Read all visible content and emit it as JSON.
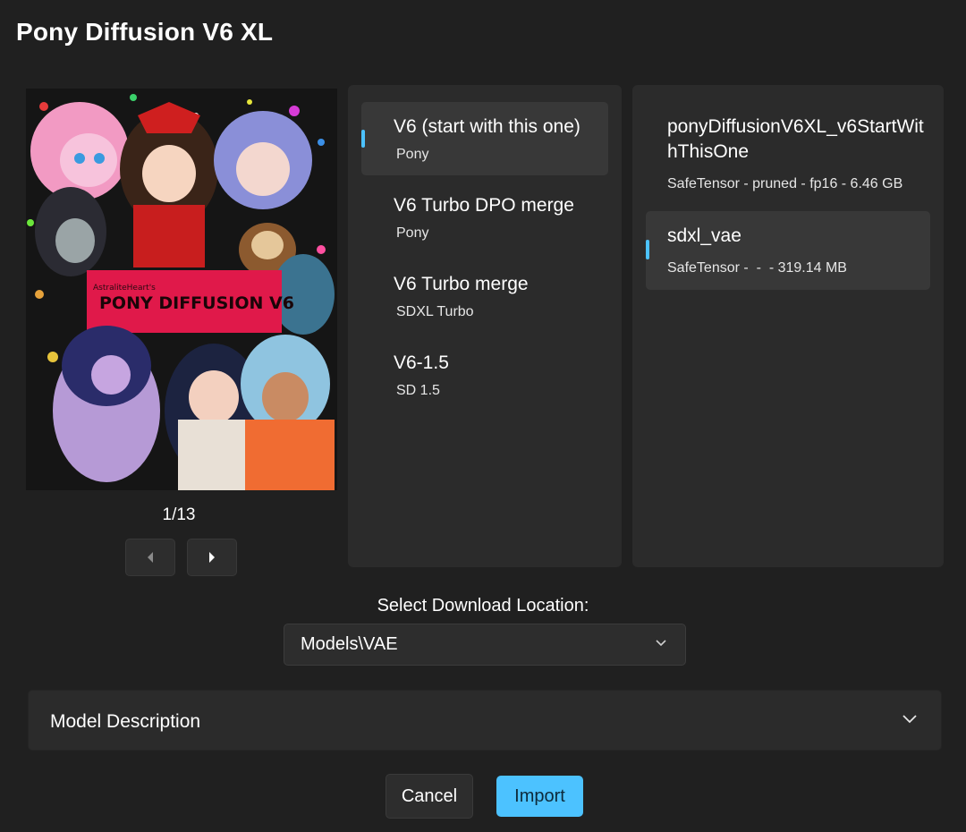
{
  "window": {
    "title": "Pony Diffusion V6 XL"
  },
  "preview": {
    "image_label": "PONY DIFFUSION V6",
    "image_credit": "AstraliteHeart's",
    "page_indicator": "1/13",
    "prev_icon": "caret-left-icon",
    "next_icon": "caret-right-icon"
  },
  "versions": {
    "items": [
      {
        "name": "V6 (start with this one)",
        "base": "Pony",
        "selected": true
      },
      {
        "name": "V6 Turbo DPO merge",
        "base": "Pony",
        "selected": false
      },
      {
        "name": "V6 Turbo merge",
        "base": "SDXL Turbo",
        "selected": false
      },
      {
        "name": "V6-1.5",
        "base": "SD 1.5",
        "selected": false
      }
    ]
  },
  "files": {
    "items": [
      {
        "name": "ponyDiffusionV6XL_v6StartWithThisOne",
        "meta": "SafeTensor - pruned - fp16 - 6.46 GB",
        "selected": false
      },
      {
        "name": "sdxl_vae",
        "meta": "SafeTensor -  -  - 319.14 MB",
        "selected": true
      }
    ]
  },
  "download": {
    "label": "Select Download Location:",
    "selected": "Models\\VAE"
  },
  "description": {
    "label": "Model Description"
  },
  "actions": {
    "cancel": "Cancel",
    "import": "Import"
  },
  "colors": {
    "accent": "#4cc2ff",
    "background": "#202020",
    "panel": "#2b2b2b"
  }
}
